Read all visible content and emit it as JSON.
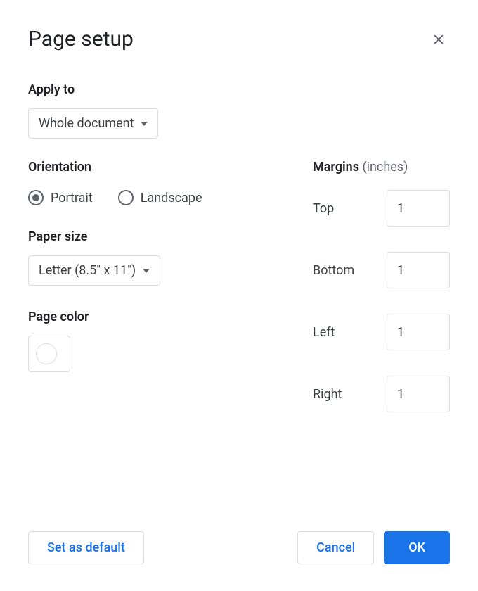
{
  "dialog": {
    "title": "Page setup"
  },
  "apply": {
    "label": "Apply to",
    "selected": "Whole document"
  },
  "orientation": {
    "label": "Orientation",
    "options": {
      "portrait": "Portrait",
      "landscape": "Landscape"
    },
    "selected": "portrait"
  },
  "paperSize": {
    "label": "Paper size",
    "selected": "Letter (8.5\" x 11\")"
  },
  "pageColor": {
    "label": "Page color",
    "selected": "#ffffff"
  },
  "margins": {
    "label": "Margins",
    "unit": "(inches)",
    "top": {
      "label": "Top",
      "value": "1"
    },
    "bottom": {
      "label": "Bottom",
      "value": "1"
    },
    "left": {
      "label": "Left",
      "value": "1"
    },
    "right": {
      "label": "Right",
      "value": "1"
    }
  },
  "footer": {
    "setDefault": "Set as default",
    "cancel": "Cancel",
    "ok": "OK"
  }
}
